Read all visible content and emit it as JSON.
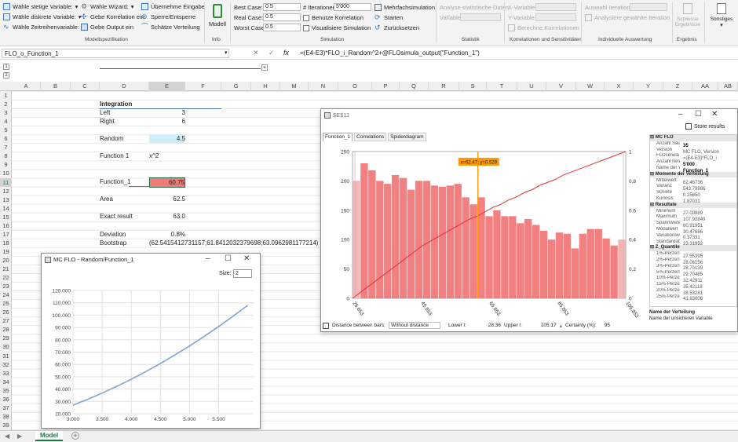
{
  "ribbon": {
    "modell": {
      "items": [
        "Wähle stetige Variable:",
        "Wähle diskrete Variable:",
        "Wähle Zeitreihenvariable:"
      ],
      "wizard": "Wähle Wizard:",
      "korrelation": "Gebe Korrelation ein",
      "output": "Gebe Output ein",
      "uebernehme": "Übernehme Eingabe",
      "sperre": "Sperre/Entsperre",
      "schaetze": "Schätze Verteilung",
      "group": "Modellspezifikation"
    },
    "info": {
      "button": "Modell",
      "group": "Info"
    },
    "simulation": {
      "best_label": "Best Case:",
      "best_value": "0.5",
      "real_label": "Real Case:",
      "real_value": "0.5",
      "worst_label": "Worst Case:",
      "worst_value": "0.5",
      "iter_label": "# Iterationen:",
      "iter_value": "5'000",
      "benutze": "Benutze Korrelation",
      "visualisiere": "Visualisiere Simulation",
      "mehrfach": "Mehrfachsimulation",
      "starten": "Starten",
      "zurueck": "Zurücksetzen",
      "group": "Simulation"
    },
    "statistik": {
      "title": "Analyse statistische Daten",
      "variable": "Variable",
      "group": "Statistik"
    },
    "korrel": {
      "x": "X-Variable",
      "y": "Y-Variable",
      "berechne": "Berechne Korrelationen",
      "group": "Korrelationen und Sensitivitäten"
    },
    "einzel": {
      "auswahl": "Auswahl Iteration",
      "analysiere": "Analysiere gewählte Iteration",
      "group": "Individuelle Auswertung"
    },
    "ergebnis": {
      "schliesse": "Schliesse",
      "ergebnisse": "Ergebnisse",
      "group": "Ergebnis"
    },
    "sonstiges": {
      "label": "Sonstiges"
    }
  },
  "formula": {
    "name_box": "FLO_o_Function_1",
    "fx": "fx",
    "content": "=(E4-E3)*FLO_i_Random^2+@FLOsimula_output(\"Function_1\")"
  },
  "columns": [
    "A",
    "B",
    "C",
    "D",
    "E",
    "F",
    "G",
    "H",
    "M",
    "N",
    "O",
    "P",
    "Q",
    "R",
    "S",
    "T",
    "U",
    "V",
    "W",
    "X",
    "Y",
    "Z",
    "AA",
    "AB"
  ],
  "rows": [
    "1",
    "2",
    "3",
    "4",
    "5",
    "6",
    "7",
    "8",
    "9",
    "10",
    "11",
    "12",
    "13",
    "14",
    "15",
    "16",
    "17",
    "18",
    "19",
    "20",
    "21",
    "22",
    "23",
    "24",
    "25",
    "26",
    "27",
    "28",
    "29",
    "30",
    "31",
    "32",
    "33",
    "34",
    "35",
    "36",
    "37",
    "38",
    "39"
  ],
  "cells": {
    "integration": "Integration",
    "left_label": "Left",
    "left_val": "3",
    "right_label": "Right",
    "right_val": "6",
    "random_label": "Random",
    "random_val": "4.5",
    "function_label": "Function 1",
    "function_val": "x^2",
    "function1_label": "Function_1",
    "function1_val": "60.75",
    "area_label": "Area",
    "area_val": "62.5",
    "exact_label": "Exact result",
    "exact_val": "63.0",
    "deviation_label": "Deviation",
    "deviation_val": "0.8%",
    "bootstrap_label": "Bootstrap",
    "bootstrap_val": "(62.5415412731157;61.8412032379698;63.0962981177214)"
  },
  "win_plot": {
    "title": "MC FLO - Random/Function_1",
    "size_label": "Size:",
    "size_val": "2",
    "controls": [
      "–",
      "☐",
      "✕"
    ]
  },
  "win_hist": {
    "title": "$E$11",
    "controls": [
      "–",
      "☐",
      "✕"
    ],
    "tabs": [
      "Function_1",
      "Correlations",
      "Spiderdiagram"
    ],
    "store": "Store results",
    "tooltip": "x=62.47, y=0.529",
    "distance_label": "Distance between bars:",
    "distance_val": "Without distance",
    "lower_label": "Lower l:",
    "lower_val": "28.36",
    "upper_label": "Upper l:",
    "upper_val": "105.17",
    "certainty_label": "Certainty (%):",
    "certainty_val": "95",
    "footer_title": "Name der Verteilung",
    "footer_desc": "Name der unsicheren Variable"
  },
  "stats": [
    {
      "type": "sec",
      "label": "MC FLO"
    },
    {
      "label": "Anzahl Säul",
      "value": "35",
      "bold": true
    },
    {
      "label": "Version",
      "value": "MC FLO, Version"
    },
    {
      "label": "FLOsimula",
      "value": "=(E4-E3)*FLO_i"
    },
    {
      "label": "Anzahl Itera",
      "value": "5'000",
      "bold": true
    },
    {
      "label": "Name der Ve",
      "value": "Function_1",
      "bold": true
    },
    {
      "type": "sec",
      "label": "Momente der Verteilung"
    },
    {
      "label": "Mittelwert",
      "value": "62.46736"
    },
    {
      "label": "Varianz",
      "value": "543.79986"
    },
    {
      "label": "Schiefe",
      "value": "0.25650"
    },
    {
      "label": "Kurtosis",
      "value": "1.87031"
    },
    {
      "type": "sec",
      "label": "Resultate"
    },
    {
      "label": "Minimum",
      "value": "27.00889"
    },
    {
      "label": "Maximum",
      "value": "107.92840"
    },
    {
      "label": "Spannweite",
      "value": "80.91951"
    },
    {
      "label": "Modalwert",
      "value": "30.47686"
    },
    {
      "label": "Variationsko",
      "value": "0.37331"
    },
    {
      "label": "Standardabw",
      "value": "23.31952"
    },
    {
      "type": "sec",
      "label": "Z_Quantile"
    },
    {
      "label": "1%-Perzentil",
      "value": "27.55395"
    },
    {
      "label": "2%-Perzentil",
      "value": "28.06156"
    },
    {
      "label": "3%-Perzentil",
      "value": "28.70139"
    },
    {
      "label": "5%-Perzentil",
      "value": "29.70465"
    },
    {
      "label": "10%-Perzentil",
      "value": "32.42911"
    },
    {
      "label": "15%-Perzentil",
      "value": "35.42118"
    },
    {
      "label": "20%-Perzentil",
      "value": "38.53281"
    },
    {
      "label": "25%-Perzentil",
      "value": "41.93006"
    }
  ],
  "sheet_tab": "Model",
  "chart_data": [
    {
      "type": "line",
      "x": [
        3.0,
        3.25,
        3.5,
        3.75,
        4.0,
        4.25,
        4.5,
        4.75,
        5.0,
        5.25,
        5.5,
        5.75,
        6.0
      ],
      "y": [
        27,
        31.6,
        36.75,
        42.2,
        48,
        54.2,
        60.75,
        67.7,
        75,
        82.7,
        90.75,
        99.2,
        108
      ],
      "xticks": [
        "3.000",
        "3.500",
        "4.000",
        "4.500",
        "5.000",
        "5.500"
      ],
      "yticks": [
        "20.000",
        "30.000",
        "40.000",
        "50.000",
        "60.000",
        "70.000",
        "80.000",
        "90.000",
        "100.000",
        "110.000",
        "120.000"
      ],
      "xlim": [
        3.0,
        6.1
      ],
      "ylim": [
        20,
        120
      ],
      "color": "#7fa3d4",
      "grid": true
    },
    {
      "type": "bar",
      "bars": [
        200,
        230,
        218,
        200,
        195,
        210,
        205,
        185,
        200,
        200,
        192,
        190,
        192,
        195,
        172,
        160,
        172,
        140,
        150,
        140,
        140,
        128,
        135,
        125,
        115,
        100,
        112,
        110,
        85,
        110,
        118,
        118,
        102,
        90,
        100
      ],
      "bar_color": "#f28080",
      "cumulative": [
        0,
        0.04,
        0.08,
        0.12,
        0.16,
        0.2,
        0.24,
        0.28,
        0.32,
        0.36,
        0.39,
        0.42,
        0.45,
        0.48,
        0.51,
        0.54,
        0.56,
        0.59,
        0.62,
        0.64,
        0.67,
        0.69,
        0.72,
        0.74,
        0.77,
        0.79,
        0.81,
        0.84,
        0.86,
        0.88,
        0.9,
        0.92,
        0.94,
        0.96,
        0.98,
        1.0
      ],
      "cumulative_color": "#e03030",
      "xticks": [
        "25.653",
        "45.853",
        "65.853",
        "85.853",
        "105.853"
      ],
      "yticks_left": [
        "0",
        "50",
        "100",
        "150",
        "200",
        "250"
      ],
      "yticks_right": [
        "0",
        "0.2",
        "0.4",
        "0.6",
        "0.8",
        "1"
      ],
      "ylim": [
        0,
        250
      ],
      "marker_x": 62.47,
      "marker_color": "#ff9900"
    }
  ]
}
